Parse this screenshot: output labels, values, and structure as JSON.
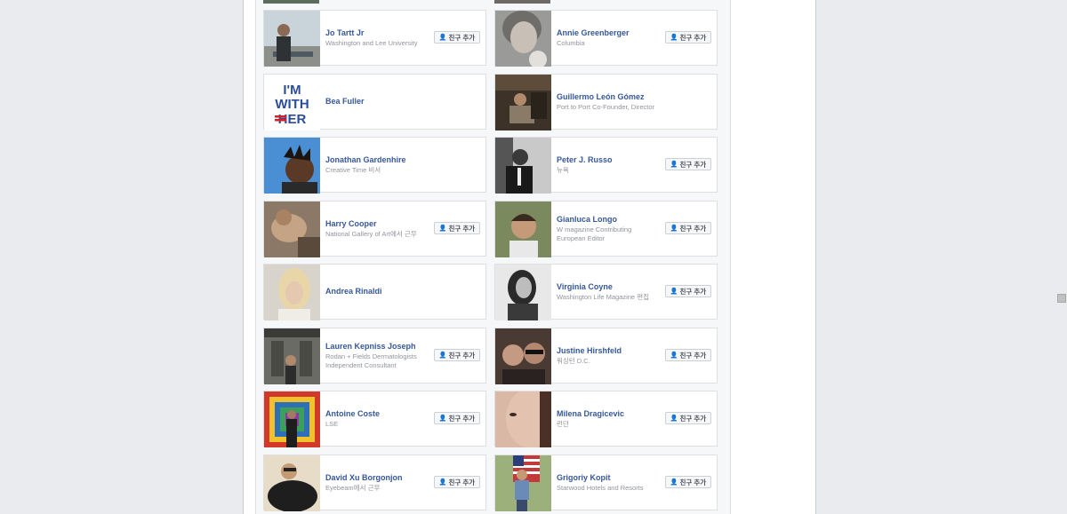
{
  "colors": {
    "name_link": "#365899",
    "sub_text": "#90949c",
    "accent_blue": "#2c4d9b",
    "hillary_red": "#d61f26"
  },
  "add_friend_label": "친구 추가",
  "add_friend_icon": "add-friend-icon",
  "people": [
    {
      "name": "Jo Tartt Jr",
      "sub1": "Washington and Lee University",
      "sub2": "",
      "has_button": true,
      "avatar": "avatar-photo-jo"
    },
    {
      "name": "Annie Greenberger",
      "sub1": "Columbia",
      "sub2": "",
      "has_button": true,
      "avatar": "avatar-photo-annie"
    },
    {
      "name": "Bea Fuller",
      "sub1": "",
      "sub2": "",
      "has_button": false,
      "avatar": "avatar-im-with-her",
      "avatar_text": [
        "I'M",
        "WITH",
        "HER"
      ]
    },
    {
      "name": "Guillermo León Gómez",
      "sub1": "Port to Port Co-Founder, Director",
      "sub2": "",
      "has_button": false,
      "avatar": "avatar-photo-guillermo"
    },
    {
      "name": "Jonathan Gardenhire",
      "sub1": "Creative Time 비서",
      "sub2": "",
      "has_button": false,
      "avatar": "avatar-photo-jonathan"
    },
    {
      "name": "Peter J. Russo",
      "sub1": "뉴욕",
      "sub2": "",
      "has_button": true,
      "avatar": "avatar-photo-peter"
    },
    {
      "name": "Harry Cooper",
      "sub1": "National Gallery of Art에서 근무",
      "sub2": "",
      "has_button": true,
      "avatar": "avatar-photo-harry"
    },
    {
      "name": "Gianluca Longo",
      "sub1": "W magazine Contributing",
      "sub2": "European Editor",
      "has_button": true,
      "avatar": "avatar-photo-gianluca"
    },
    {
      "name": "Andrea Rinaldi",
      "sub1": "",
      "sub2": "",
      "has_button": false,
      "avatar": "avatar-photo-andrea"
    },
    {
      "name": "Virginia Coyne",
      "sub1": "Washington Life Magazine 편집",
      "sub2": "",
      "has_button": true,
      "avatar": "avatar-photo-virginia"
    },
    {
      "name": "Lauren Kepniss Joseph",
      "sub1": "Rodan + Fields Dermatologists",
      "sub2": "Independent Consultant",
      "has_button": true,
      "avatar": "avatar-photo-lauren"
    },
    {
      "name": "Justine Hirshfeld",
      "sub1": "워싱턴 D.C.",
      "sub2": "",
      "has_button": true,
      "avatar": "avatar-photo-justine"
    },
    {
      "name": "Antoine Coste",
      "sub1": "LSE",
      "sub2": "",
      "has_button": true,
      "avatar": "avatar-photo-antoine"
    },
    {
      "name": "Milena Dragicevic",
      "sub1": "런던",
      "sub2": "",
      "has_button": true,
      "avatar": "avatar-photo-milena"
    },
    {
      "name": "David Xu Borgonjon",
      "sub1": "Eyebeam에서 근무",
      "sub2": "",
      "has_button": true,
      "avatar": "avatar-photo-david"
    },
    {
      "name": "Grigoriy Kopit",
      "sub1": "Starwood Hotels and Resorts",
      "sub2": "",
      "has_button": true,
      "avatar": "avatar-photo-grigoriy"
    }
  ]
}
